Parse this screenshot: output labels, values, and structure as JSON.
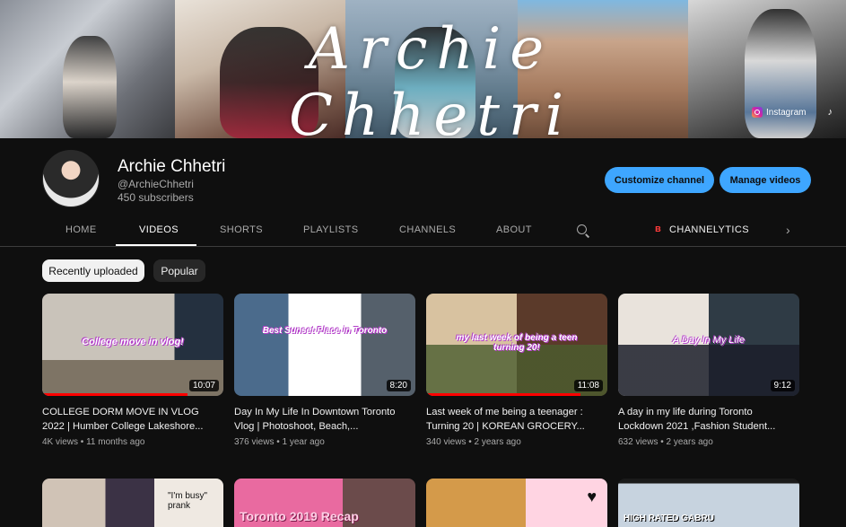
{
  "banner": {
    "title": "Archie Chhetri",
    "social_instagram": "Instagram"
  },
  "channel": {
    "name": "Archie Chhetri",
    "handle": "@ArchieChhetri",
    "subscribers": "450 subscribers",
    "customize_label": "Customize channel",
    "manage_label": "Manage videos"
  },
  "tabs": [
    {
      "label": "HOME",
      "active": false
    },
    {
      "label": "VIDEOS",
      "active": true
    },
    {
      "label": "SHORTS",
      "active": false
    },
    {
      "label": "PLAYLISTS",
      "active": false
    },
    {
      "label": "CHANNELS",
      "active": false
    },
    {
      "label": "ABOUT",
      "active": false
    }
  ],
  "extension_tab": "CHANNELYTICS",
  "chips": {
    "recent": "Recently uploaded",
    "popular": "Popular"
  },
  "videos": [
    {
      "title": "COLLEGE DORM MOVE IN VLOG 2022 | Humber College Lakeshore...",
      "views": "4K views",
      "age": "11 months ago",
      "duration": "10:07",
      "overlay": "College move in vlog!",
      "watched": 0.8
    },
    {
      "title": "Day In My Life In Downtown Toronto Vlog | Photoshoot, Beach,...",
      "views": "376 views",
      "age": "1 year ago",
      "duration": "8:20",
      "overlay": "Best Sunset Place in Toronto",
      "watched": 0
    },
    {
      "title": "Last week of me being a teenager : Turning 20 | KOREAN GROCERY...",
      "views": "340 views",
      "age": "2 years ago",
      "duration": "11:08",
      "overlay": "my last week of being a teen turning 20!",
      "watched": 0.85
    },
    {
      "title": "A day in my life during Toronto Lockdown 2021 ,Fashion Student...",
      "views": "632 views",
      "age": "2 years ago",
      "duration": "9:12",
      "overlay": "A Day In My Life",
      "watched": 0
    }
  ],
  "videos_row2": [
    {
      "overlay": "\"I'm busy\" prank"
    },
    {
      "overlay": "Toronto 2019 Recap"
    },
    {
      "overlay": ""
    },
    {
      "overlay": "HIGH RATED GABRU"
    }
  ],
  "colors": {
    "background": "#0f0f0f",
    "accent_blue": "#3ea6ff",
    "progress_red": "#ff0000"
  }
}
